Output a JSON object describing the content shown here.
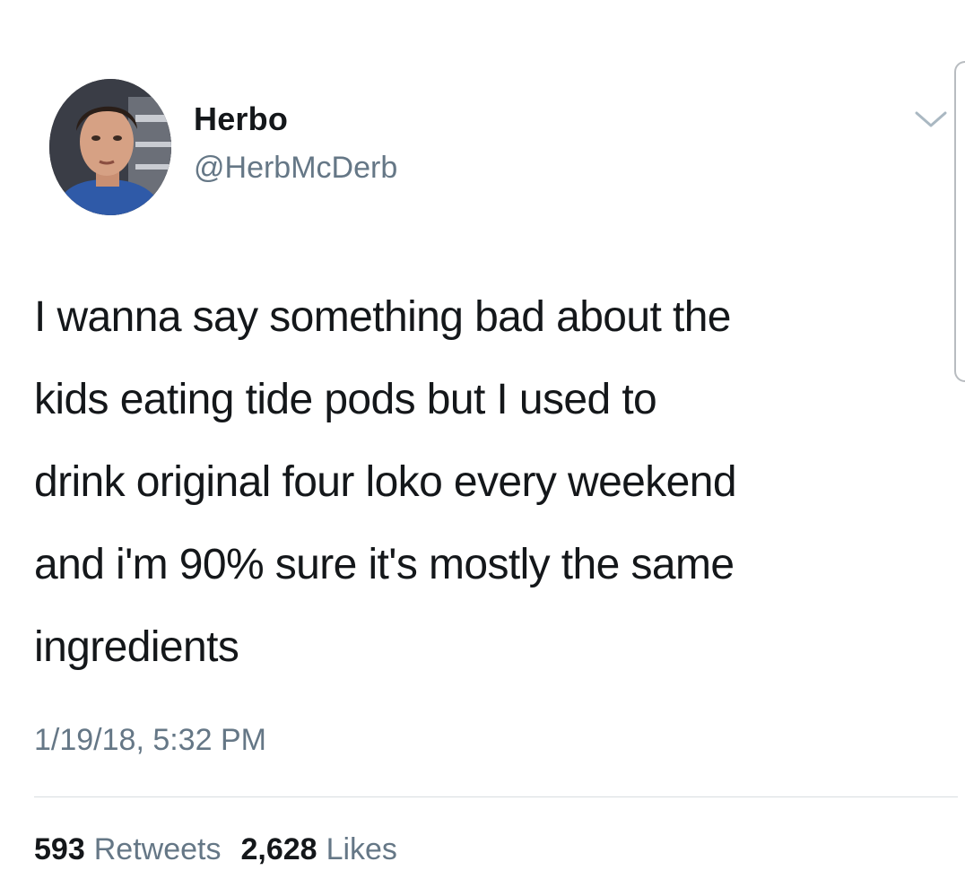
{
  "author": {
    "display_name": "Herbo",
    "handle": "@HerbMcDerb",
    "avatar_icon": "profile-photo"
  },
  "tweet": {
    "text": "I wanna say something bad about the\nkids eating tide pods but I used to\ndrink original four loko every weekend\nand i'm 90% sure it's mostly the same\ningredients",
    "timestamp": "1/19/18, 5:32 PM"
  },
  "stats": {
    "retweets_count": "593",
    "retweets_label": "Retweets",
    "likes_count": "2,628",
    "likes_label": "Likes"
  },
  "icons": {
    "menu": "chevron-down-icon"
  },
  "colors": {
    "text_primary": "#14171a",
    "text_secondary": "#657786",
    "divider": "#d8dde1"
  }
}
